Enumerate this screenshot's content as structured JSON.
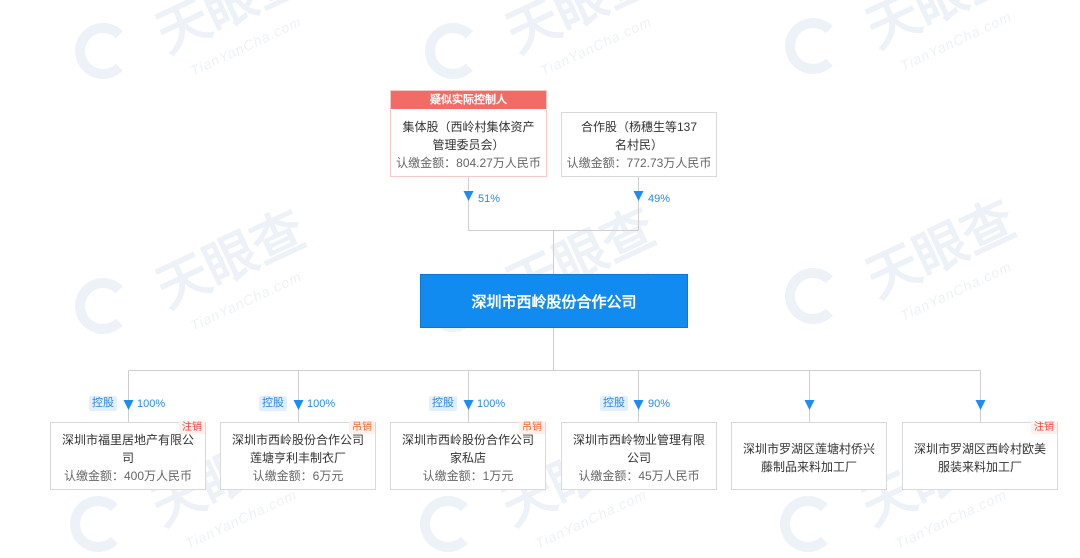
{
  "theme": {
    "primary": "#128bf0",
    "primary_border": "#0a78d6",
    "arrow": "#1e8cf0",
    "percent_text": "#2a8be6",
    "connector": "#cfcfcf",
    "node_border": "#d9d9d9",
    "controller_border": "#f7c9c4",
    "controller_tag": "#f26b66",
    "holding_tag_bg": "#e1efff",
    "holding_tag_text": "#2d86e3",
    "status_cancelled": "#f2433b",
    "status_revoked": "#f36a2f",
    "status_bg": "#fff0ec",
    "text": "#333333",
    "subtext": "#666666",
    "watermark": "#edf2f8"
  },
  "watermark": {
    "brand": "天眼查",
    "domain": "TianYanCha.com"
  },
  "shareholders": [
    {
      "tag": "疑似实际控制人",
      "name_lines": [
        "集体股（西岭村集体资产",
        "管理委员会）"
      ],
      "amount": "认缴金额：804.27万人民币",
      "percent": "51%"
    },
    {
      "name_lines": [
        "合作股（杨穗生等137",
        "名村民）"
      ],
      "amount": "认缴金额：772.73万人民币",
      "percent": "49%"
    }
  ],
  "company": {
    "name": "深圳市西岭股份合作公司"
  },
  "investments": [
    {
      "relation": "控股",
      "percent": "100%",
      "status": "注销",
      "name_lines": [
        "深圳市福里居地产有限公",
        "司"
      ],
      "amount": "认缴金额：400万人民币"
    },
    {
      "relation": "控股",
      "percent": "100%",
      "status": "吊销",
      "name_lines": [
        "深圳市西岭股份合作公司",
        "莲塘亨利丰制衣厂"
      ],
      "amount": "认缴金额：6万元"
    },
    {
      "relation": "控股",
      "percent": "100%",
      "status": "吊销",
      "name_lines": [
        "深圳市西岭股份合作公司",
        "家私店"
      ],
      "amount": "认缴金额：1万元"
    },
    {
      "relation": "控股",
      "percent": "90%",
      "name_lines": [
        "深圳市西岭物业管理有限",
        "公司"
      ],
      "amount": "认缴金额：45万人民币"
    },
    {
      "name_lines": [
        "深圳市罗湖区莲塘村侨兴",
        "藤制品来料加工厂"
      ]
    },
    {
      "status": "注销",
      "name_lines": [
        "深圳市罗湖区西岭村欧美",
        "服装来料加工厂"
      ]
    }
  ]
}
